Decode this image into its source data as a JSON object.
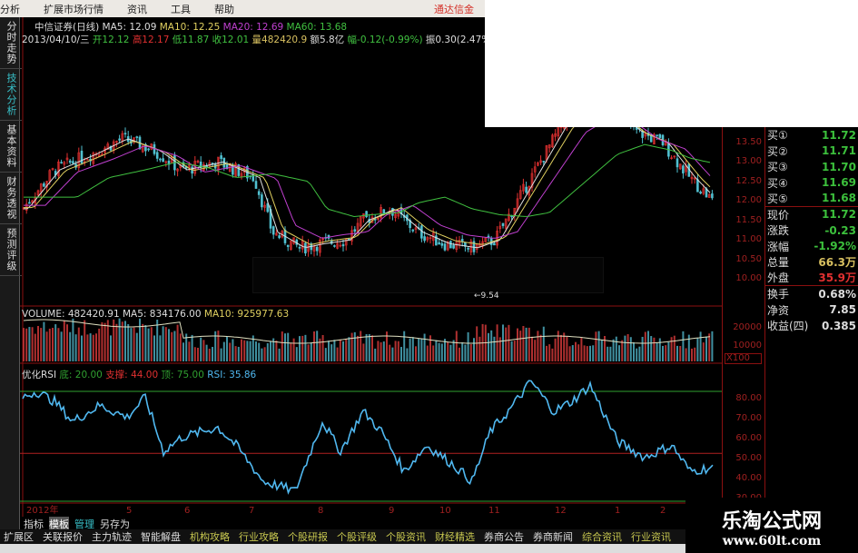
{
  "menu": {
    "items": [
      "分析",
      "扩展市场行情",
      "资讯",
      "工具",
      "帮助"
    ],
    "brand": "通达信金"
  },
  "left_tabs": [
    "分时走势",
    "技术分析",
    "基本资料",
    "财务透视",
    "预测评级"
  ],
  "price_header": {
    "name": "中信证券(日线)",
    "ma5": "MA5: 12.09",
    "ma10": "MA10: 12.25",
    "ma20": "MA20: 12.69",
    "ma60": "MA60: 13.68",
    "date": "2013/04/10/三",
    "open": "开12.12",
    "high": "高12.17",
    "low": "低11.87",
    "close": "收12.01",
    "vol": "量482420.9",
    "amount": "额5.8亿",
    "change": "幅-0.12(-0.99%)",
    "amp": "振0.30(2.47%)"
  },
  "price_axis": [
    "13.50",
    "13.00",
    "12.50",
    "12.00",
    "11.50",
    "11.00",
    "10.50",
    "10.00"
  ],
  "low_marker": "←9.54",
  "volume_header": {
    "volume": "VOLUME: 482420.91",
    "ma5": "MA5: 834176.00",
    "ma10": "MA10: 925977.63"
  },
  "volume_axis": [
    "20000",
    "10000"
  ],
  "volume_unit": "X100",
  "rsi_header": {
    "name": "优化RSI",
    "low": "底: 20.00",
    "support": "支撑: 44.00",
    "top": "顶: 75.00",
    "rsi": "RSI: 35.86"
  },
  "rsi_axis": [
    "80.00",
    "70.00",
    "60.00",
    "50.00",
    "40.00",
    "30.00"
  ],
  "date_axis": [
    "2012年",
    "5",
    "6",
    "7",
    "8",
    "9",
    "10",
    "11",
    "12",
    "1",
    "2",
    "3"
  ],
  "quote": [
    {
      "label": "买①",
      "value": "11.72",
      "color": "#3cc03c"
    },
    {
      "label": "买②",
      "value": "11.71",
      "color": "#3cc03c"
    },
    {
      "label": "买③",
      "value": "11.70",
      "color": "#3cc03c"
    },
    {
      "label": "买④",
      "value": "11.69",
      "color": "#3cc03c"
    },
    {
      "label": "买⑤",
      "value": "11.68",
      "color": "#3cc03c"
    },
    {
      "label": "现价",
      "value": "11.72",
      "color": "#3cc03c"
    },
    {
      "label": "涨跌",
      "value": "-0.23",
      "color": "#3cc03c"
    },
    {
      "label": "涨幅",
      "value": "-1.92%",
      "color": "#3cc03c"
    },
    {
      "label": "总量",
      "value": "66.3万",
      "color": "#d8c060"
    },
    {
      "label": "外盘",
      "value": "35.9万",
      "color": "#e03030"
    },
    {
      "label": "换手",
      "value": "0.68%",
      "color": "#ddd"
    },
    {
      "label": "净资",
      "value": "7.85",
      "color": "#ddd"
    },
    {
      "label": "收益(四)",
      "value": "0.385",
      "color": "#ddd"
    }
  ],
  "bottom_tabs": [
    "指标",
    "模板",
    "管理",
    "另存为"
  ],
  "bottom_bar": [
    {
      "label": "扩展区",
      "color": "#ddd"
    },
    {
      "label": "关联报价",
      "color": "#ddd"
    },
    {
      "label": "主力轨迹",
      "color": "#ddd"
    },
    {
      "label": "智能解盘",
      "color": "#ddd"
    },
    {
      "label": "机构攻略",
      "color": "#c8c850"
    },
    {
      "label": "行业攻略",
      "color": "#c8c850"
    },
    {
      "label": "个股研报",
      "color": "#c8c850"
    },
    {
      "label": "个股评级",
      "color": "#c8c850"
    },
    {
      "label": "个股资讯",
      "color": "#c8c850"
    },
    {
      "label": "财经精选",
      "color": "#c8c850"
    },
    {
      "label": "券商公告",
      "color": "#ddd"
    },
    {
      "label": "券商新闻",
      "color": "#ddd"
    },
    {
      "label": "综合资讯",
      "color": "#c8c850"
    },
    {
      "label": "行业资讯",
      "color": "#c8c850"
    }
  ],
  "watermark": {
    "title": "乐淘公式网",
    "url": "www.60lt.com"
  },
  "colors": {
    "up": "#e03030",
    "down": "#50c0d0",
    "rsi": "#50b8f0",
    "grid": "#8b1010"
  }
}
